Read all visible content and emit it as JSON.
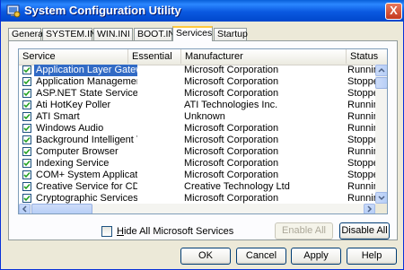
{
  "window": {
    "title": "System Configuration Utility",
    "close_label": "X"
  },
  "tabs": [
    {
      "label": "General"
    },
    {
      "label": "SYSTEM.INI"
    },
    {
      "label": "WIN.INI"
    },
    {
      "label": "BOOT.INI"
    },
    {
      "label": "Services",
      "active": true
    },
    {
      "label": "Startup"
    }
  ],
  "list": {
    "columns": [
      "Service",
      "Essential",
      "Manufacturer",
      "Status"
    ],
    "rows": [
      {
        "service": "Application Layer Gatew...",
        "essential": "",
        "manufacturer": "Microsoft Corporation",
        "status": "Running",
        "checked": true,
        "selected": true
      },
      {
        "service": "Application Management",
        "essential": "",
        "manufacturer": "Microsoft Corporation",
        "status": "Stopped",
        "checked": true
      },
      {
        "service": "ASP.NET State Service",
        "essential": "",
        "manufacturer": "Microsoft Corporation",
        "status": "Stopped",
        "checked": true
      },
      {
        "service": "Ati HotKey Poller",
        "essential": "",
        "manufacturer": "ATI Technologies Inc.",
        "status": "Running",
        "checked": true
      },
      {
        "service": "ATI Smart",
        "essential": "",
        "manufacturer": "Unknown",
        "status": "Running",
        "checked": true
      },
      {
        "service": "Windows Audio",
        "essential": "",
        "manufacturer": "Microsoft Corporation",
        "status": "Running",
        "checked": true
      },
      {
        "service": "Background Intelligent T...",
        "essential": "",
        "manufacturer": "Microsoft Corporation",
        "status": "Stopped",
        "checked": true
      },
      {
        "service": "Computer Browser",
        "essential": "",
        "manufacturer": "Microsoft Corporation",
        "status": "Running",
        "checked": true
      },
      {
        "service": "Indexing Service",
        "essential": "",
        "manufacturer": "Microsoft Corporation",
        "status": "Stopped",
        "checked": true
      },
      {
        "service": "COM+ System Application",
        "essential": "",
        "manufacturer": "Microsoft Corporation",
        "status": "Stopped",
        "checked": true
      },
      {
        "service": "Creative Service for CD...",
        "essential": "",
        "manufacturer": "Creative Technology Ltd",
        "status": "Running",
        "checked": true
      },
      {
        "service": "Cryptographic Services",
        "essential": "",
        "manufacturer": "Microsoft Corporation",
        "status": "Running",
        "checked": true
      }
    ]
  },
  "hide_ms": {
    "label_prefix": "H",
    "label_rest": "ide All Microsoft Services",
    "checked": false
  },
  "buttons": {
    "enable_all": "Enable All",
    "disable_all": "Disable All",
    "ok": "OK",
    "cancel": "Cancel",
    "apply": "Apply",
    "help": "Help"
  },
  "colors": {
    "titlebar": "#0a59e0",
    "selection": "#316ac5",
    "tab_highlight": "#ffc83c"
  }
}
